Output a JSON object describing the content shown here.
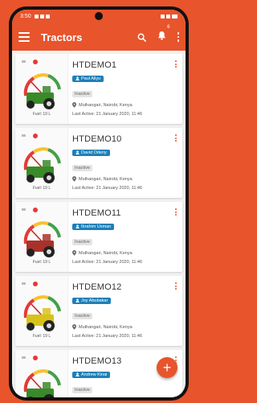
{
  "status_bar": {
    "time": "3:50"
  },
  "app_bar": {
    "title": "Tractors",
    "notification_count": "6"
  },
  "colors": {
    "accent": "#e8542c",
    "operator_badge": "#1e7fb8"
  },
  "tractors": [
    {
      "name": "HTDEMO1",
      "operator": "Paul Aliyu",
      "status": "Inactive",
      "location": "Muthangari, Nairobi, Kenya",
      "last_active": "Last Active: 21 January 2020, 11:46",
      "fuel": "Fuel: 19 L",
      "vehicle_color": "#3a8a2a"
    },
    {
      "name": "HTDEMO10",
      "operator": "David Odeny",
      "status": "Inactive",
      "location": "Muthangari, Nairobi, Kenya",
      "last_active": "Last Active: 21 January 2020, 11:46",
      "fuel": "Fuel: 19 L",
      "vehicle_color": "#3a8a2a"
    },
    {
      "name": "HTDEMO11",
      "operator": "Ibrahim Usman",
      "status": "Inactive",
      "location": "Muthangari, Nairobi, Kenya",
      "last_active": "Last Active: 21 January 2020, 11:46",
      "fuel": "Fuel: 19 L",
      "vehicle_color": "#a8322a"
    },
    {
      "name": "HTDEMO12",
      "operator": "Joy Abubakar",
      "status": "Inactive",
      "location": "Muthangari, Nairobi, Kenya",
      "last_active": "Last Active: 21 January 2020, 11:46",
      "fuel": "Fuel: 19 L",
      "vehicle_color": "#d8c21a"
    },
    {
      "name": "HTDEMO13",
      "operator": "Andrew Kinai",
      "status": "Inactive",
      "location": "Muthangari, Nairobi, Kenya",
      "last_active": "Last Active: 21 January 2020, 11:46",
      "fuel": "Fuel: 19 L",
      "vehicle_color": "#3a8a2a"
    }
  ],
  "fab": {
    "label": "+"
  }
}
